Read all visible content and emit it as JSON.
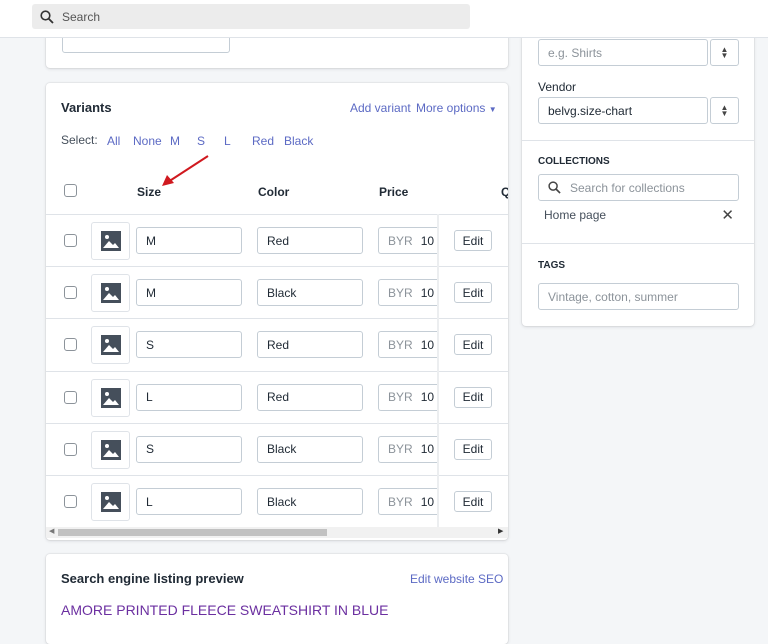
{
  "topbar": {
    "search_placeholder": "Search"
  },
  "variants": {
    "title": "Variants",
    "add_variant": "Add variant",
    "more_options": "More options",
    "select_label": "Select:",
    "select_options": [
      "All",
      "None",
      "M",
      "S",
      "L",
      "Red",
      "Black"
    ],
    "columns": {
      "size": "Size",
      "color": "Color",
      "price": "Price",
      "quantity_partial": "Q"
    },
    "rows": [
      {
        "size": "M",
        "color": "Red",
        "currency": "BYR",
        "price": "10",
        "edit": "Edit"
      },
      {
        "size": "M",
        "color": "Black",
        "currency": "BYR",
        "price": "10",
        "edit": "Edit"
      },
      {
        "size": "S",
        "color": "Red",
        "currency": "BYR",
        "price": "10",
        "edit": "Edit"
      },
      {
        "size": "L",
        "color": "Red",
        "currency": "BYR",
        "price": "10",
        "edit": "Edit"
      },
      {
        "size": "S",
        "color": "Black",
        "currency": "BYR",
        "price": "10",
        "edit": "Edit"
      },
      {
        "size": "L",
        "color": "Black",
        "currency": "BYR",
        "price": "10",
        "edit": "Edit"
      }
    ]
  },
  "seo": {
    "title": "Search engine listing preview",
    "edit_link": "Edit website SEO",
    "preview_title": "AMORE PRINTED FLEECE SWEATSHIRT IN BLUE"
  },
  "organization": {
    "type_placeholder": "e.g. Shirts",
    "vendor_label": "Vendor",
    "vendor_value": "belvg.size-chart",
    "collections_label": "COLLECTIONS",
    "collections_placeholder": "Search for collections",
    "collection_items": [
      "Home page"
    ],
    "tags_label": "TAGS",
    "tags_placeholder": "Vintage, cotton, summer"
  },
  "colors": {
    "link": "#5c6ac4",
    "preview_title": "#6b2fa0",
    "annotation_arrow": "#d0191f"
  }
}
